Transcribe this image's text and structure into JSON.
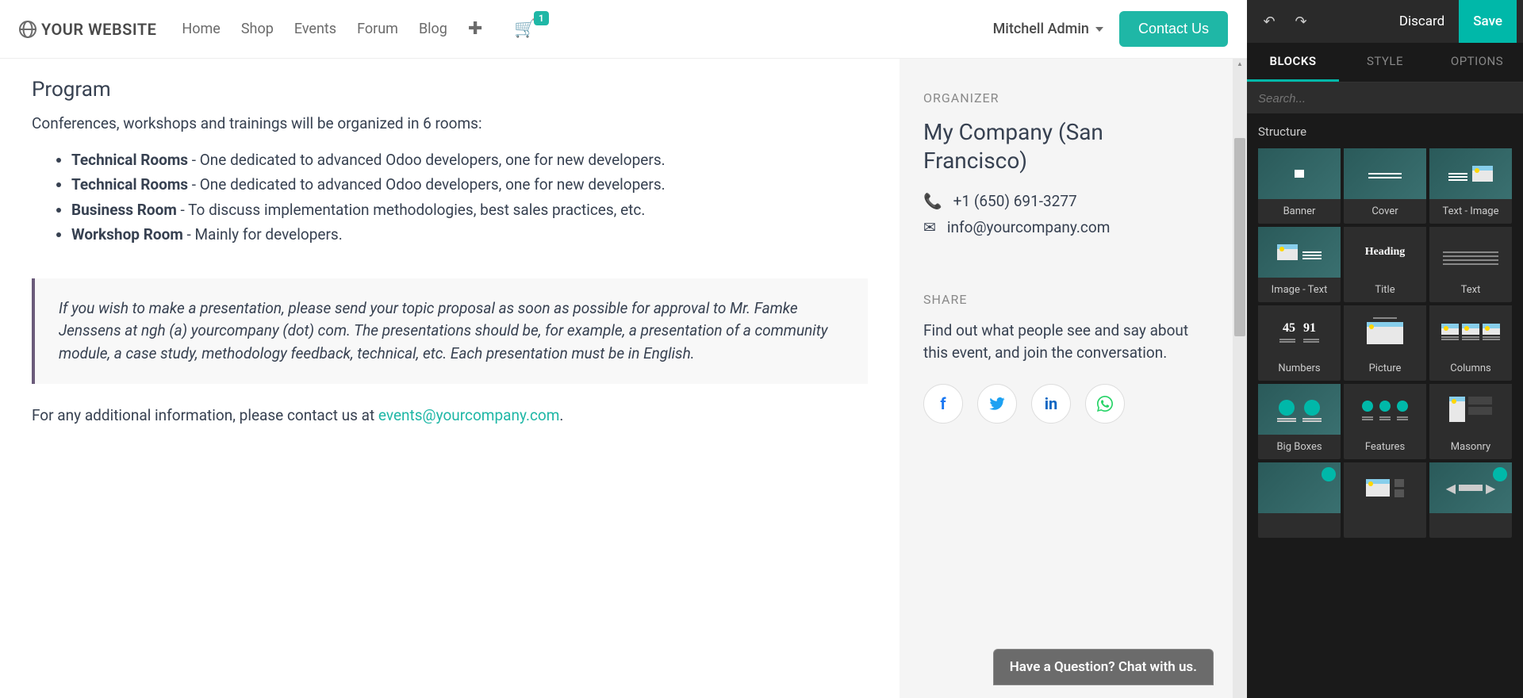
{
  "topbar": {
    "logo_text": "YOUR WEBSITE",
    "nav": [
      "Home",
      "Shop",
      "Events",
      "Forum",
      "Blog"
    ],
    "cart_count": "1",
    "user": "Mitchell Admin",
    "contact_btn": "Contact Us"
  },
  "program": {
    "title": "Program",
    "intro": "Conferences, workshops and trainings will be organized in 6 rooms:",
    "rooms": [
      {
        "name": "Technical Rooms",
        "desc": " - One dedicated to advanced Odoo developers, one for new developers."
      },
      {
        "name": "Technical Rooms",
        "desc": " - One dedicated to advanced Odoo developers, one for new developers."
      },
      {
        "name": "Business Room",
        "desc": " - To discuss implementation methodologies, best sales practices, etc."
      },
      {
        "name": "Workshop Room",
        "desc": " - Mainly for developers."
      }
    ],
    "quote": "If you wish to make a presentation, please send your topic proposal as soon as possible for approval to Mr. Famke Jenssens at ngh (a) yourcompany (dot) com. The presentations should be, for example, a presentation of a community module, a case study, methodology feedback, technical, etc. Each presentation must be in English.",
    "contact_prefix": "For any additional information, please contact us at ",
    "contact_email": "events@yourcompany.com"
  },
  "organizer": {
    "label": "ORGANIZER",
    "name": "My Company (San Francisco)",
    "phone": "+1 (650) 691-3277",
    "email": "info@yourcompany.com"
  },
  "share": {
    "label": "SHARE",
    "text": "Find out what people see and say about this event, and join the conversation."
  },
  "chat": {
    "text": "Have a Question? Chat with us."
  },
  "editor": {
    "discard": "Discard",
    "save": "Save",
    "tabs": [
      "BLOCKS",
      "STYLE",
      "OPTIONS"
    ],
    "search_placeholder": "Search...",
    "section": "Structure",
    "blocks": [
      "Banner",
      "Cover",
      "Text - Image",
      "Image - Text",
      "Title",
      "Text",
      "Numbers",
      "Picture",
      "Columns",
      "Big Boxes",
      "Features",
      "Masonry"
    ]
  }
}
